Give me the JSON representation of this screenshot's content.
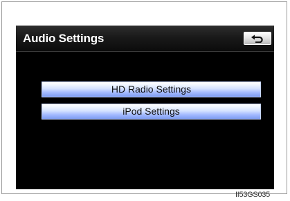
{
  "screen": {
    "title": "Audio Settings",
    "back_button_icon": "back-arrow-icon",
    "menu": [
      {
        "label": "HD Radio Settings"
      },
      {
        "label": "iPod Settings"
      }
    ]
  },
  "colors": {
    "screen_background": "#000000",
    "button_highlight": "#d5e2ff",
    "button_shadow": "#7e9df2"
  },
  "figure_code": "II53GS035"
}
